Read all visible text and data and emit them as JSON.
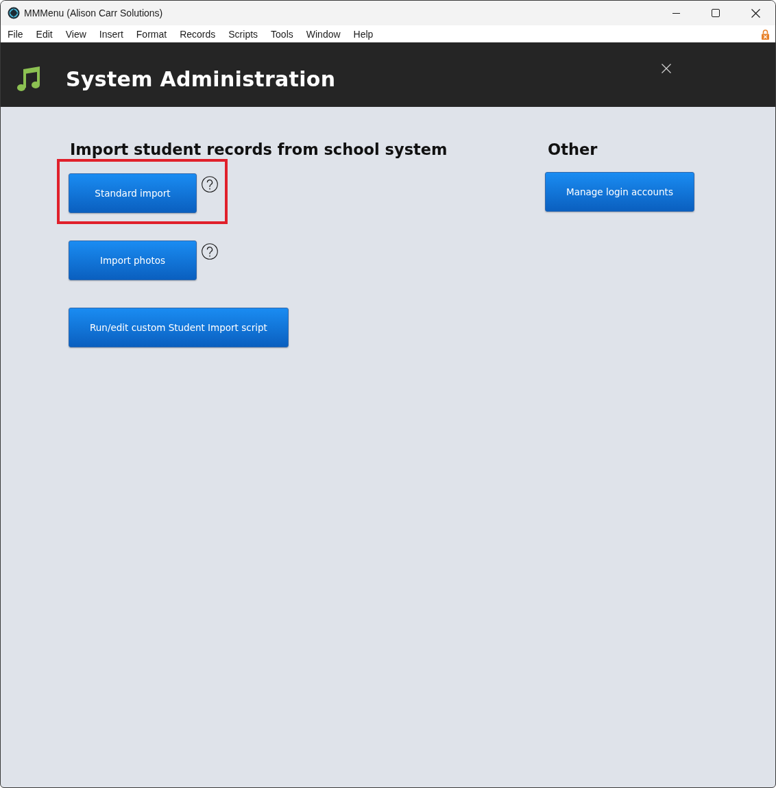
{
  "window": {
    "title": "MMMenu (Alison Carr Solutions)"
  },
  "menu_bar": {
    "items": [
      "File",
      "Edit",
      "View",
      "Insert",
      "Format",
      "Records",
      "Scripts",
      "Tools",
      "Window",
      "Help"
    ]
  },
  "header": {
    "title": "System Administration"
  },
  "sections": [
    {
      "heading": "Import student records from school system",
      "buttons": [
        {
          "label": "Standard import",
          "help": true,
          "highlighted": true
        },
        {
          "label": "Import photos",
          "help": true,
          "highlighted": false
        },
        {
          "label": "Run/edit custom Student Import script",
          "help": false,
          "highlighted": false
        }
      ]
    },
    {
      "heading": "Other",
      "buttons": [
        {
          "label": "Manage login accounts",
          "help": false,
          "highlighted": false
        }
      ]
    }
  ]
}
